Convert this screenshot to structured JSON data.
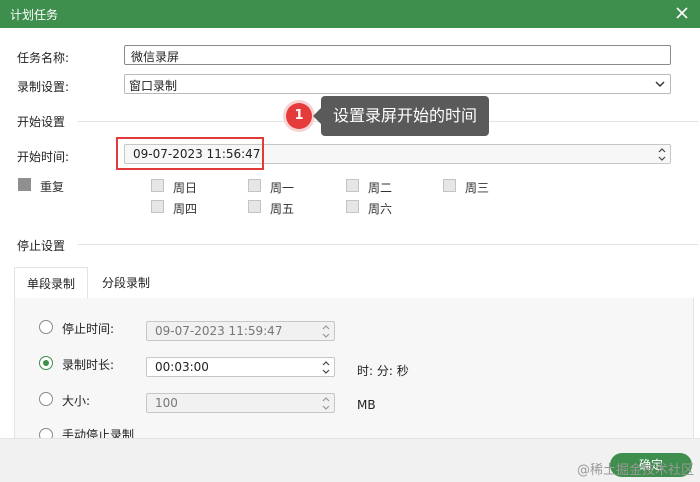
{
  "window": {
    "title": "计划任务"
  },
  "task_name": {
    "label": "任务名称:",
    "value": "微信录屏"
  },
  "record_settings": {
    "label": "录制设置:",
    "value": "窗口录制"
  },
  "start_section": {
    "title": "开始设置"
  },
  "tooltip": {
    "number": "1",
    "text": "设置录屏开始的时间"
  },
  "start_time": {
    "label": "开始时间:",
    "value": "09-07-2023 11:56:47"
  },
  "repeat": {
    "label": "重复",
    "days": [
      "周日",
      "周一",
      "周二",
      "周三",
      "周四",
      "周五",
      "周六"
    ]
  },
  "stop_section": {
    "title": "停止设置"
  },
  "tabs": [
    {
      "label": "单段录制",
      "active": true
    },
    {
      "label": "分段录制",
      "active": false
    }
  ],
  "stop_options": {
    "stop_time": {
      "label": "停止时间:",
      "value": "09-07-2023 11:59:47",
      "selected": false
    },
    "duration": {
      "label": "录制时长:",
      "value": "00:03:00",
      "unit": "时: 分: 秒",
      "selected": true
    },
    "size": {
      "label": "大小:",
      "value": "100",
      "unit": "MB",
      "selected": false
    },
    "manual": {
      "label": "手动停止录制",
      "selected": false
    }
  },
  "footer": {
    "ok_label": "确定",
    "watermark": "@稀土掘金技术社区"
  },
  "colors": {
    "accent": "#3e8e4d",
    "highlight": "#e03a3a",
    "tooltip_bg": "#5a5a5a"
  }
}
